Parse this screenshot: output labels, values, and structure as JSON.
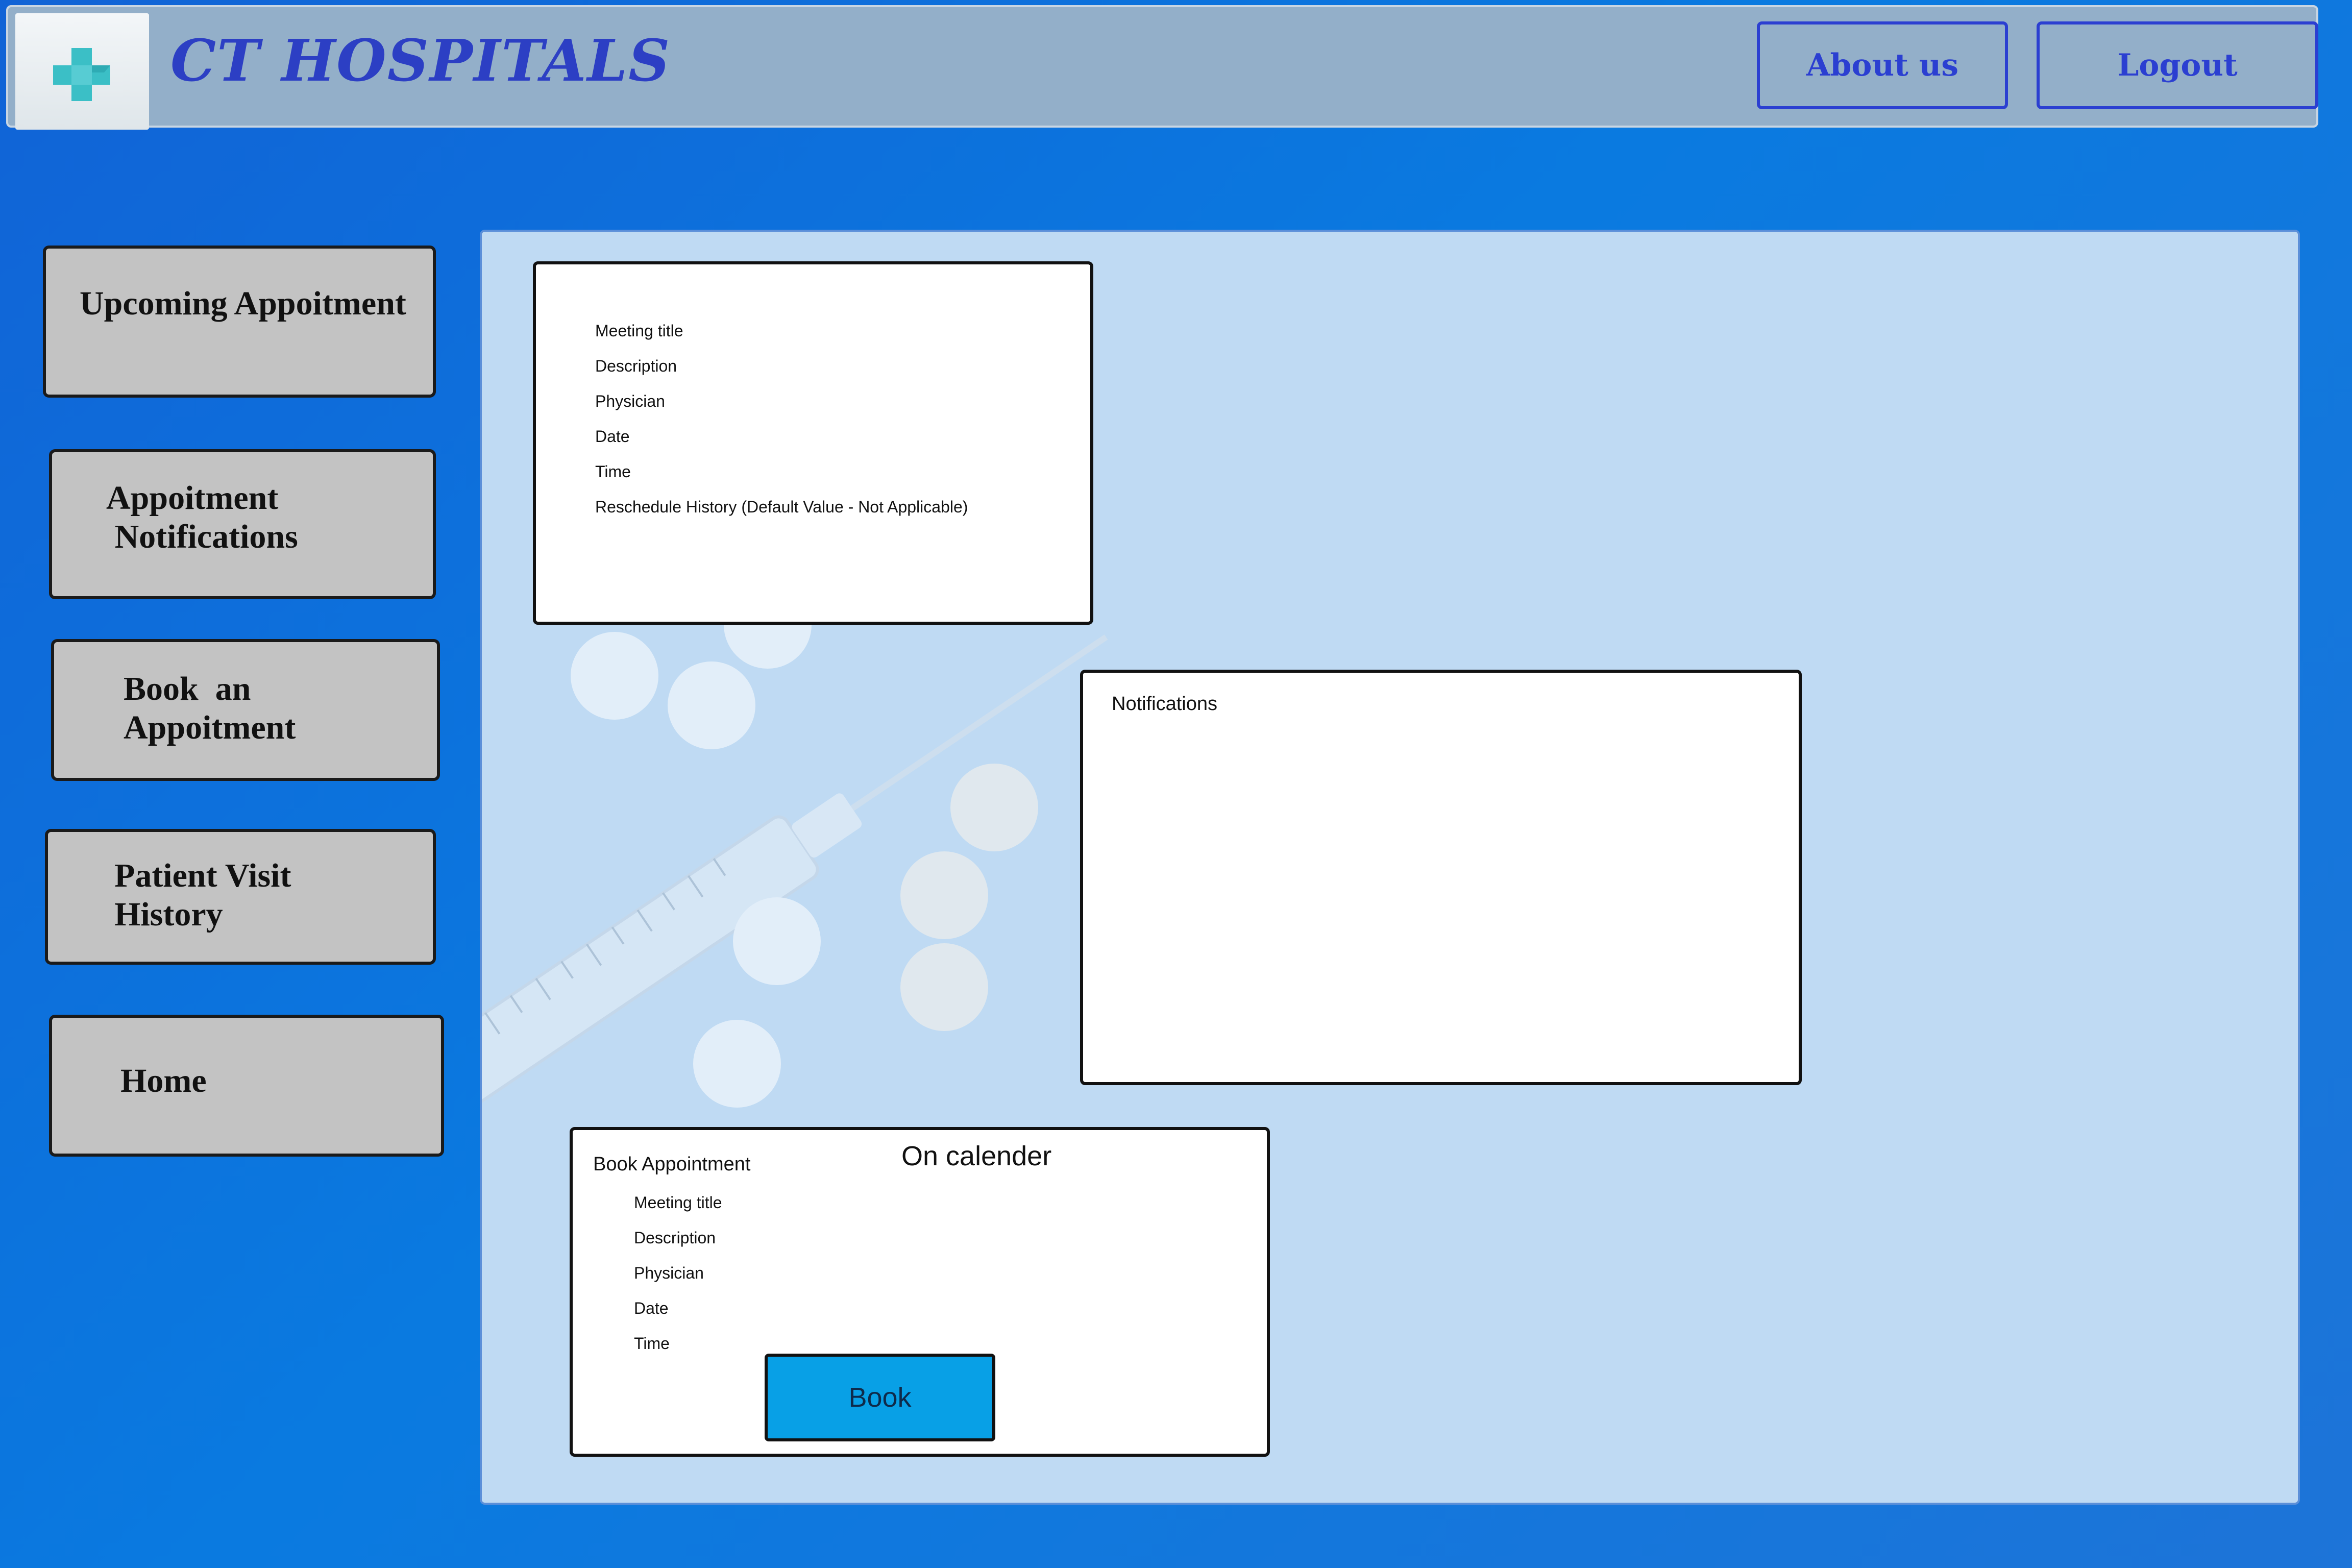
{
  "header": {
    "brand": "CT HOSPITALS",
    "logo_icon": "plus-cross-icon",
    "about_label": "About us",
    "logout_label": "Logout"
  },
  "sidebar": {
    "items": [
      {
        "label": "Upcoming Appoitment"
      },
      {
        "label": "Appoitment\n Notifications"
      },
      {
        "label": "Book  an\nAppoitment"
      },
      {
        "label": "Patient Visit\nHistory"
      },
      {
        "label": "Home"
      }
    ]
  },
  "upcoming_card": {
    "fields": [
      "Meeting title",
      "Description",
      "Physician",
      "Date",
      "Time",
      "Reschedule History (Default Value - Not Applicable)"
    ]
  },
  "notifications_card": {
    "title": "Notifications"
  },
  "book_card": {
    "title": "Book Appointment",
    "calendar_label": "On calender",
    "fields": [
      "Meeting title",
      "Description",
      "Physician",
      "Date",
      "Time"
    ],
    "button_label": "Book"
  },
  "colors": {
    "brand": "#2c3fc4",
    "background": "#0a7ae0",
    "panel": "#bfdaf3",
    "book_button": "#08a0e6",
    "nav_button": "#c3c3c3"
  }
}
